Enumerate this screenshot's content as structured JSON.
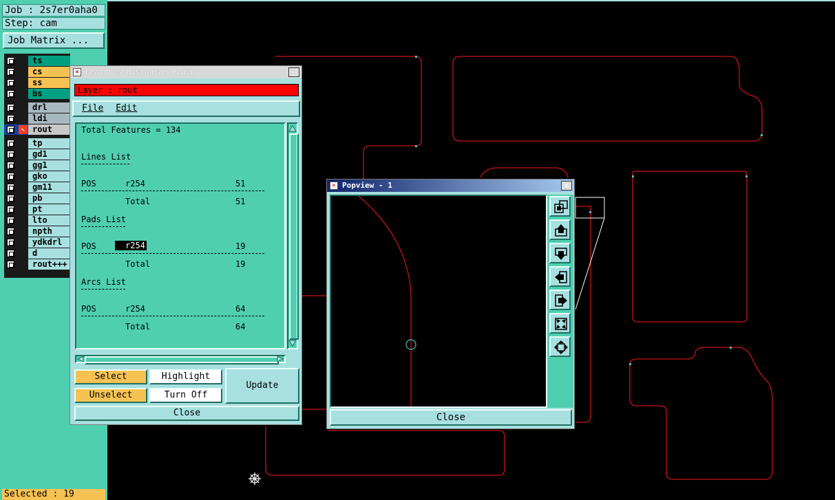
{
  "left_panel": {
    "job": "Job : 2s7er0aha0",
    "step": "Step: cam",
    "job_matrix_label": "Job Matrix ...",
    "layers": [
      {
        "name": "ts",
        "color": "#00a080"
      },
      {
        "name": "cs",
        "color": "#f7c254"
      },
      {
        "name": "ss",
        "color": "#f7c254"
      },
      {
        "name": "bs",
        "color": "#00a080"
      },
      {
        "name": "drl",
        "color": "#a8b8c0"
      },
      {
        "name": "ldi",
        "color": "#a8b8c0"
      },
      {
        "name": "rout",
        "color": "#c8c8c8",
        "active": true
      },
      {
        "name": "tp",
        "color": "#a8e0e0"
      },
      {
        "name": "gd1",
        "color": "#a8e0e0"
      },
      {
        "name": "gg1",
        "color": "#a8e0e0"
      },
      {
        "name": "gko",
        "color": "#a8e0e0"
      },
      {
        "name": "gm11",
        "color": "#a8e0e0"
      },
      {
        "name": "pb",
        "color": "#a8e0e0"
      },
      {
        "name": "pt",
        "color": "#a8e0e0"
      },
      {
        "name": "lto",
        "color": "#a8e0e0"
      },
      {
        "name": "npth",
        "color": "#a8e0e0"
      },
      {
        "name": "ydkdrl",
        "color": "#a8e0e0"
      },
      {
        "name": "d",
        "color": "#a8e0e0"
      },
      {
        "name": "rout+++",
        "color": "#a8e0e0"
      }
    ],
    "selected_status": "Selected : 19"
  },
  "histogram": {
    "title": "Features Histogram Popup",
    "layer_label": "Layer :  rout",
    "menu": {
      "file": "File",
      "edit": "Edit"
    },
    "total_features": "Total Features = 134",
    "lines_header": "Lines List",
    "pads_header": "Pads List",
    "arcs_header": "Arcs List",
    "lines_row": {
      "pos": "POS",
      "sym": "r254",
      "count": "51"
    },
    "lines_total": {
      "label": "Total",
      "count": "51"
    },
    "pads_row": {
      "pos": "POS",
      "sym": "r254",
      "count": "19"
    },
    "pads_total": {
      "label": "Total",
      "count": "19"
    },
    "arcs_row": {
      "pos": "POS",
      "sym": "r254",
      "count": "64"
    },
    "arcs_total": {
      "label": "Total",
      "count": "64"
    },
    "buttons": {
      "select": "Select",
      "highlight": "Highlight",
      "unselect": "Unselect",
      "turn_off": "Turn Off",
      "update": "Update",
      "close": "Close"
    }
  },
  "popview": {
    "title": "Popview - 1",
    "close_label": "Close"
  },
  "colors": {
    "rout_outline": "#c81414",
    "teal": "#4fcfb0",
    "panel_cyan": "#a8e0e0",
    "orange": "#f7c254"
  }
}
